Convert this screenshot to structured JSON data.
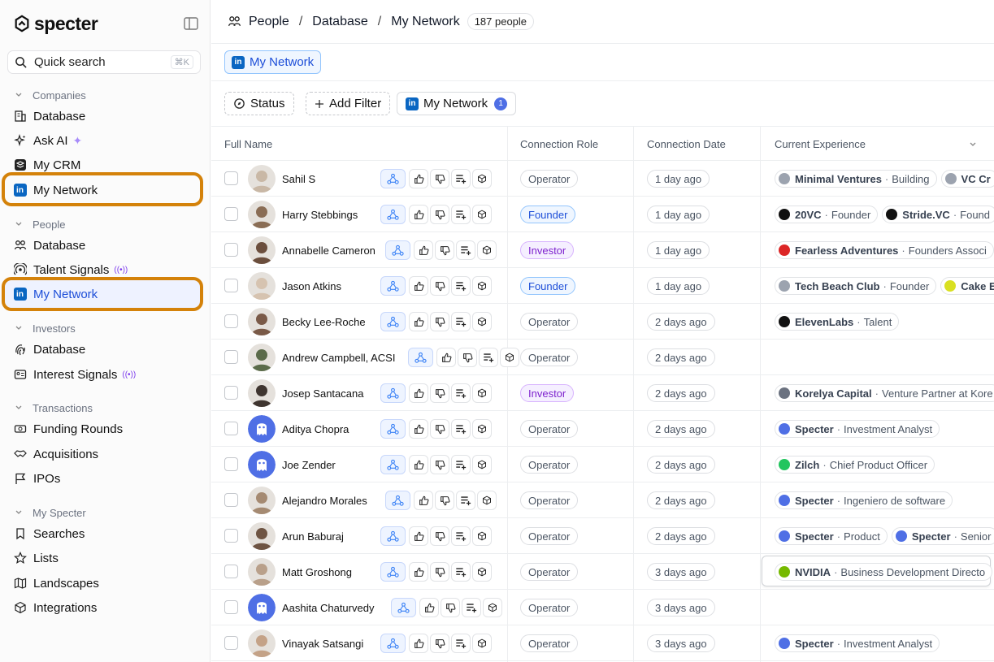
{
  "sidebar": {
    "logo_text": "specter",
    "search": {
      "label": "Quick search",
      "shortcut": "⌘K"
    },
    "sections": [
      {
        "title": "Companies",
        "items": [
          "Database",
          "Ask AI",
          "My CRM",
          "My Network"
        ]
      },
      {
        "title": "People",
        "items": [
          "Database",
          "Talent Signals",
          "My Network"
        ]
      },
      {
        "title": "Investors",
        "items": [
          "Database",
          "Interest Signals"
        ]
      },
      {
        "title": "Transactions",
        "items": [
          "Funding Rounds",
          "Acquisitions",
          "IPOs"
        ]
      },
      {
        "title": "My Specter",
        "items": [
          "Searches",
          "Lists",
          "Landscapes",
          "Integrations"
        ]
      }
    ],
    "active_item": "People / My Network",
    "accent_color": "#d4820a"
  },
  "header": {
    "breadcrumb": [
      "People",
      "Database",
      "My Network"
    ],
    "count": "187 people"
  },
  "tabs": {
    "active": "My Network"
  },
  "filters": {
    "status": "Status",
    "add_filter": "Add Filter",
    "network": "My Network",
    "network_count": "1"
  },
  "table": {
    "columns": [
      "Full Name",
      "Connection Role",
      "Connection Date",
      "Current Experience"
    ],
    "rows": [
      {
        "name": "Sahil S",
        "role": "Operator",
        "date": "1 day ago",
        "exp": [
          {
            "co": "Minimal Ventures",
            "title": "Building",
            "color": "#9ca3af"
          },
          {
            "co": "VC Cr",
            "title": "",
            "color": "#9ca3af"
          }
        ]
      },
      {
        "name": "Harry Stebbings",
        "role": "Founder",
        "date": "1 day ago",
        "exp": [
          {
            "co": "20VC",
            "title": "Founder",
            "color": "#111111"
          },
          {
            "co": "Stride.VC",
            "title": "Found",
            "color": "#111111"
          }
        ]
      },
      {
        "name": "Annabelle Cameron",
        "role": "Investor",
        "date": "1 day ago",
        "exp": [
          {
            "co": "Fearless Adventures",
            "title": "Founders Associ",
            "color": "#dc2626"
          }
        ]
      },
      {
        "name": "Jason Atkins",
        "role": "Founder",
        "date": "1 day ago",
        "exp": [
          {
            "co": "Tech Beach Club",
            "title": "Founder",
            "color": "#9ca3af"
          },
          {
            "co": "Cake E",
            "title": "",
            "color": "#d9e021"
          }
        ]
      },
      {
        "name": "Becky Lee-Roche",
        "role": "Operator",
        "date": "2 days ago",
        "exp": [
          {
            "co": "ElevenLabs",
            "title": "Talent",
            "color": "#111111"
          }
        ]
      },
      {
        "name": "Andrew Campbell, ACSI",
        "role": "Operator",
        "date": "2 days ago",
        "exp": []
      },
      {
        "name": "Josep Santacana",
        "role": "Investor",
        "date": "2 days ago",
        "exp": [
          {
            "co": "Korelya Capital",
            "title": "Venture Partner at Kore",
            "color": "#6b7280"
          }
        ]
      },
      {
        "name": "Aditya Chopra",
        "role": "Operator",
        "date": "2 days ago",
        "exp": [
          {
            "co": "Specter",
            "title": "Investment Analyst",
            "color": "#4f6fe5"
          }
        ]
      },
      {
        "name": "Joe Zender",
        "role": "Operator",
        "date": "2 days ago",
        "exp": [
          {
            "co": "Zilch",
            "title": "Chief Product Officer",
            "color": "#22c55e"
          }
        ]
      },
      {
        "name": "Alejandro Morales",
        "role": "Operator",
        "date": "2 days ago",
        "exp": [
          {
            "co": "Specter",
            "title": "Ingeniero de software",
            "color": "#4f6fe5"
          }
        ]
      },
      {
        "name": "Arun Baburaj",
        "role": "Operator",
        "date": "2 days ago",
        "exp": [
          {
            "co": "Specter",
            "title": "Product",
            "color": "#4f6fe5"
          },
          {
            "co": "Specter",
            "title": "Senior",
            "color": "#4f6fe5"
          }
        ]
      },
      {
        "name": "Matt Groshong",
        "role": "Operator",
        "date": "3 days ago",
        "exp": [
          {
            "co": "NVIDIA",
            "title": "Business Development Directo",
            "color": "#76b900"
          }
        ]
      },
      {
        "name": "Aashita Chaturvedy",
        "role": "Operator",
        "date": "3 days ago",
        "exp": []
      },
      {
        "name": "Vinayak Satsangi",
        "role": "Operator",
        "date": "3 days ago",
        "exp": [
          {
            "co": "Specter",
            "title": "Investment Analyst",
            "color": "#4f6fe5"
          }
        ]
      }
    ]
  }
}
